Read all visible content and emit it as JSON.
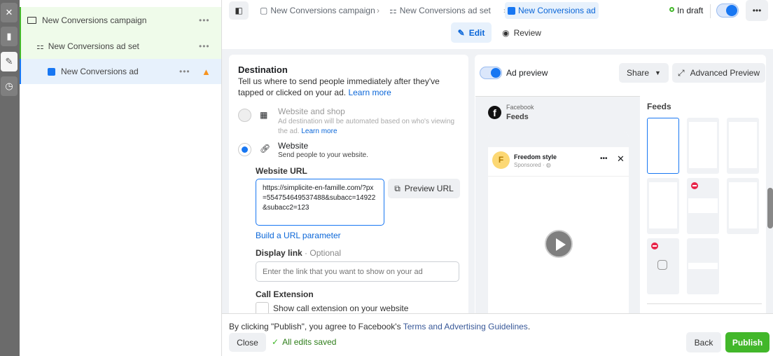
{
  "rail": {
    "icons": [
      "close-icon",
      "chart-icon",
      "pencil-icon",
      "clock-icon"
    ]
  },
  "tree": {
    "campaign": "New Conversions campaign",
    "adset": "New Conversions ad set",
    "ad": "New Conversions ad",
    "more": "•••"
  },
  "breadcrumb": {
    "campaign": "New Conversions campaign",
    "adset": "New Conversions ad set",
    "ad": "New Conversions ad"
  },
  "status": {
    "label": "In draft",
    "color": "#42b72a"
  },
  "tabs": {
    "edit": "Edit",
    "review": "Review"
  },
  "destination": {
    "title": "Destination",
    "desc": "Tell us where to send people immediately after they've tapped or clicked on your ad.",
    "learn_more": "Learn more",
    "opt1_title": "Website and shop",
    "opt1_desc": "Ad destination will be automated based on who's viewing the ad.",
    "opt1_learn": "Learn more",
    "opt2_title": "Website",
    "opt2_desc": "Send people to your website.",
    "url_label": "Website URL",
    "url_value": "https://simplicite-en-famille.com/?px=554754649537488&subacc=14922&subacc2=123",
    "preview_url": "Preview URL",
    "build_param": "Build a URL parameter",
    "display_link_label": "Display link",
    "optional": " · Optional",
    "display_link_placeholder": "Enter the link that you want to show on your ad",
    "call_ext_label": "Call Extension",
    "call_ext_checkbox": "Show call extension on your website"
  },
  "preview": {
    "toggle_label": "Ad preview",
    "share": "Share",
    "advanced": "Advanced Preview",
    "platform": "Facebook",
    "placement": "Feeds",
    "page_name": "Freedom style",
    "sponsored": "Sponsored · ",
    "avatar_letter": "F",
    "feeds_title": "Feeds"
  },
  "footer": {
    "agree_prefix": "By clicking \"Publish\", you agree to Facebook's ",
    "terms": "Terms and Advertising Guidelines",
    "agree_suffix": ".",
    "close": "Close",
    "saved": "All edits saved",
    "back": "Back",
    "publish": "Publish"
  },
  "colors": {
    "accent": "#1877f2",
    "publish": "#42b72a",
    "warning": "#f7931e"
  }
}
